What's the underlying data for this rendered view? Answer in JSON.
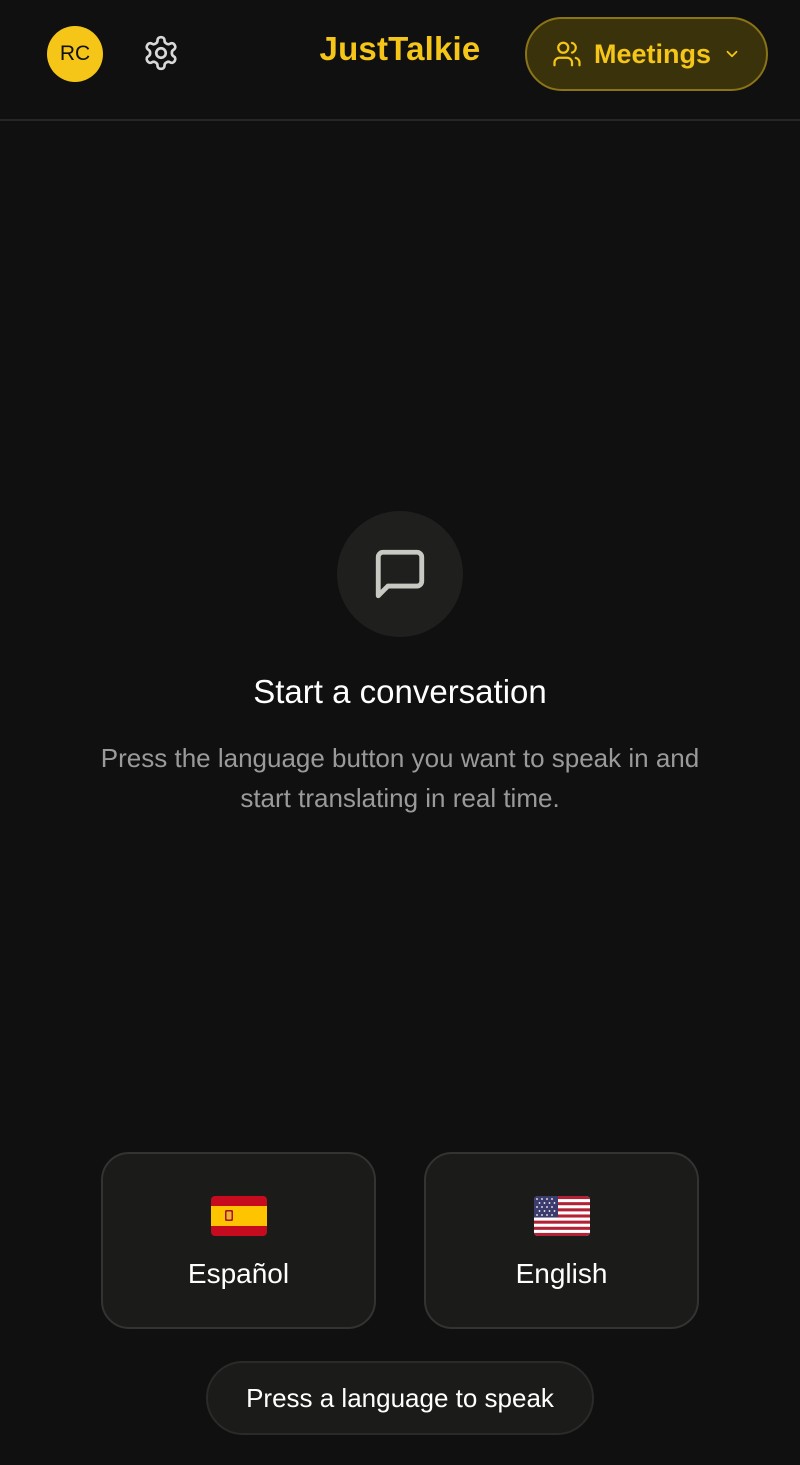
{
  "header": {
    "avatar_initials": "RC",
    "brand": "JustTalkie",
    "meetings_label": "Meetings",
    "icons": {
      "settings": "gear-icon",
      "meetings": "users-icon",
      "dropdown": "chevron-down-icon"
    }
  },
  "empty_state": {
    "icon": "chat-bubble-icon",
    "title": "Start a conversation",
    "subtitle": "Press the language button you want to speak in and start translating in real time."
  },
  "languages": [
    {
      "label": "Español",
      "flag": "spain-flag-icon"
    },
    {
      "label": "English",
      "flag": "us-flag-icon"
    }
  ],
  "hint": "Press a language to speak",
  "colors": {
    "accent": "#f5c518",
    "background": "#101010",
    "card": "#1b1b19"
  }
}
